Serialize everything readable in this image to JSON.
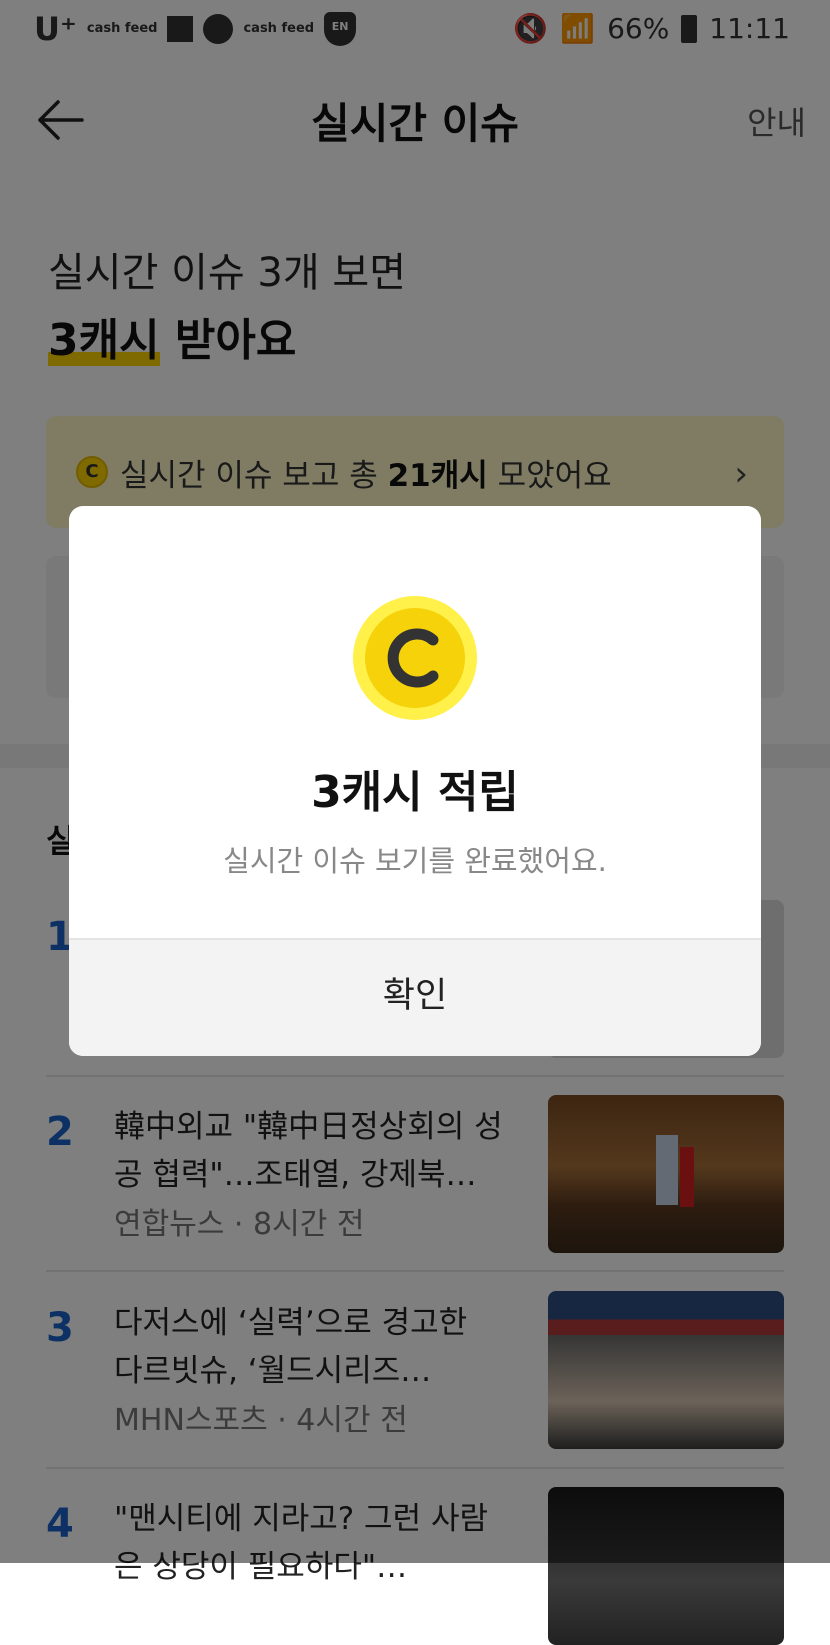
{
  "status_bar": {
    "carrier": "U⁺",
    "app_label_1": "cash feed",
    "app_label_2": "cash feed",
    "en_badge": "EN",
    "battery": "66%",
    "time": "11:11"
  },
  "header": {
    "title": "실시간 이슈",
    "guide_label": "안내"
  },
  "promo": {
    "line1": "실시간 이슈 3개 보면",
    "line2_cash": "3캐시",
    "line2_rest": " 받아요"
  },
  "summary": {
    "coin_letter": "C",
    "prefix": "실시간 이슈 보고 총 ",
    "amount": "21캐시",
    "suffix": " 모았어요",
    "arrow": "›"
  },
  "section": {
    "title_visible": "실"
  },
  "news": [
    {
      "number": "1",
      "title": "",
      "meta": ""
    },
    {
      "number": "2",
      "title": "韓中외교 \"韓中日정상회의 성공 협력\"…조태열, 강제북…",
      "meta": "연합뉴스 · 8시간 전"
    },
    {
      "number": "3",
      "title": "다저스에 ‘실력’으로 경고한 다르빗슈, ‘월드시리즈…",
      "meta": "MHN스포츠 · 4시간 전"
    },
    {
      "number": "4",
      "title": "\"맨시티에 지라고? 그런 사람은 상당이 필요하다\"…",
      "meta": ""
    }
  ],
  "modal": {
    "title": "3캐시 적립",
    "subtitle": "실시간 이슈 보기를 완료했어요.",
    "confirm_label": "확인"
  }
}
